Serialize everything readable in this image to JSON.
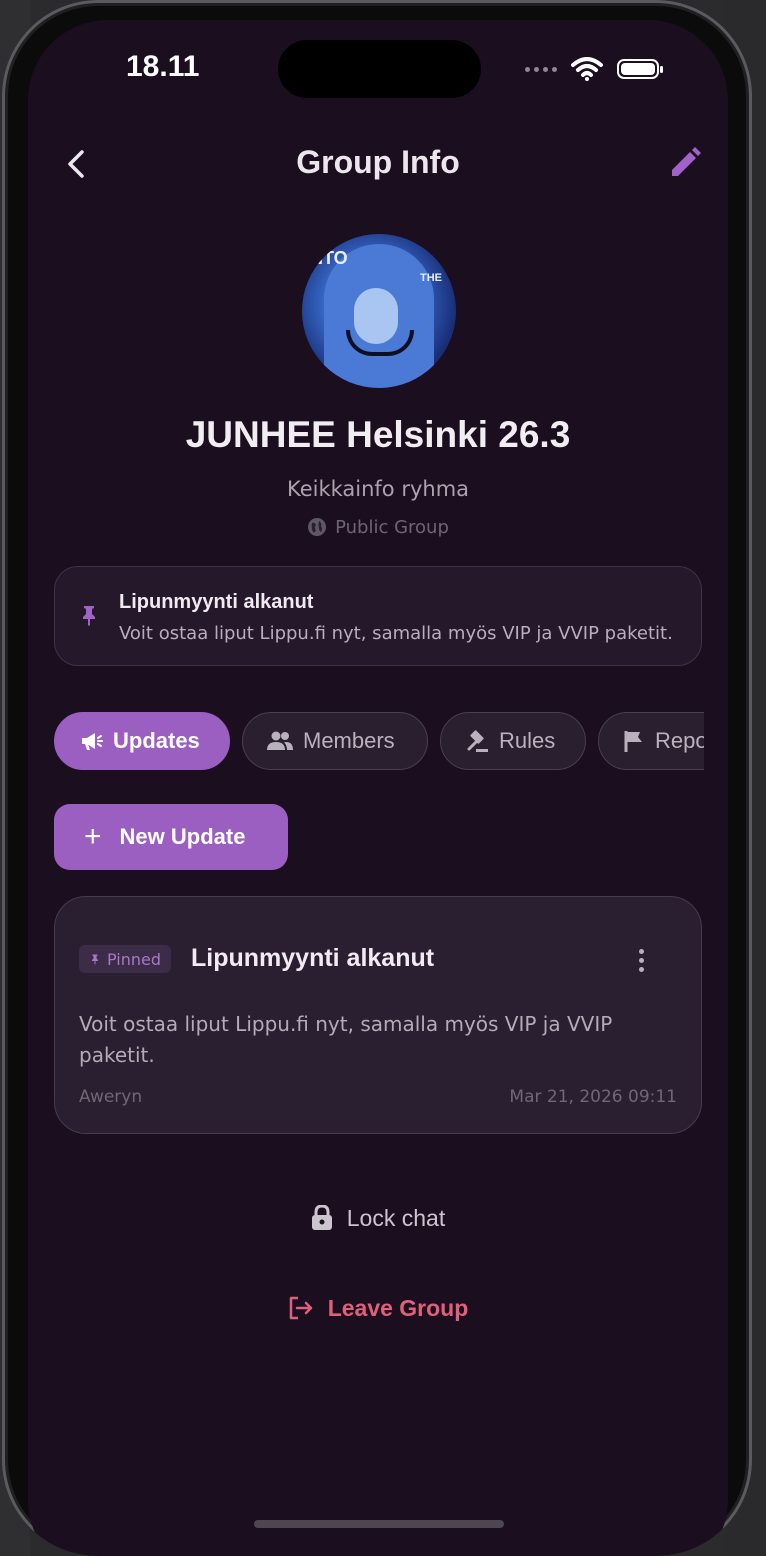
{
  "status_bar": {
    "time": "18.11"
  },
  "header": {
    "title": "Group Info",
    "back_icon": "chevron-left-icon",
    "edit_icon": "pencil-icon"
  },
  "group": {
    "name": "JUNHEE Helsinki 26.3",
    "description": "Keikkainfo ryhma",
    "type_label": "Public Group",
    "avatar_text_1": "NTO",
    "avatar_text_2": "THE"
  },
  "pinned_banner": {
    "title": "Lipunmyynti alkanut",
    "body": "Voit ostaa liput Lippu.fi nyt, samalla myös VIP ja VVIP paketit."
  },
  "tabs": [
    {
      "label": "Updates",
      "icon": "megaphone-icon",
      "active": true
    },
    {
      "label": "Members",
      "icon": "people-icon",
      "active": false
    },
    {
      "label": "Rules",
      "icon": "gavel-icon",
      "active": false
    },
    {
      "label": "Repo",
      "icon": "flag-icon",
      "active": false
    }
  ],
  "actions": {
    "new_update_label": "New Update",
    "lock_chat_label": "Lock chat",
    "leave_group_label": "Leave Group"
  },
  "update": {
    "badge": "Pinned",
    "title": "Lipunmyynti alkanut",
    "body": "Voit ostaa liput Lippu.fi nyt, samalla myös VIP ja VVIP paketit.",
    "author": "Aweryn",
    "date": "Mar 21, 2026 09:11"
  },
  "colors": {
    "accent": "#9a5fc0",
    "background": "#1b0f1f",
    "danger": "#e0607b"
  }
}
